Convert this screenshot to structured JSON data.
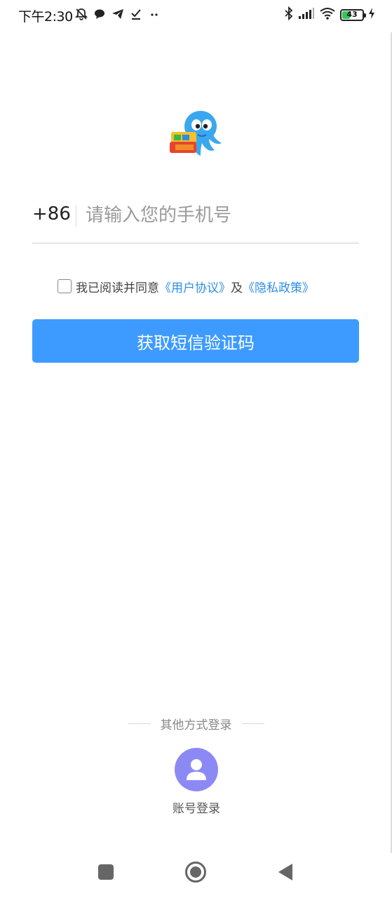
{
  "status_bar": {
    "time": "下午2:30",
    "battery_level": "43",
    "battery_fraction": 0.43
  },
  "login": {
    "country_code": "+86",
    "phone_placeholder": "请输入您的手机号",
    "agreement_prefix": "我已阅读并同意",
    "user_agreement": "《用户协议》",
    "agreement_conjunction": "及",
    "privacy_policy": "《隐私政策》",
    "sms_button_label": "获取短信验证码"
  },
  "other_login": {
    "title": "其他方式登录",
    "account_login_label": "账号登录"
  },
  "colors": {
    "accent": "#3d9bff",
    "link": "#2f8de4",
    "avatar_bg": "#8b8af5"
  }
}
